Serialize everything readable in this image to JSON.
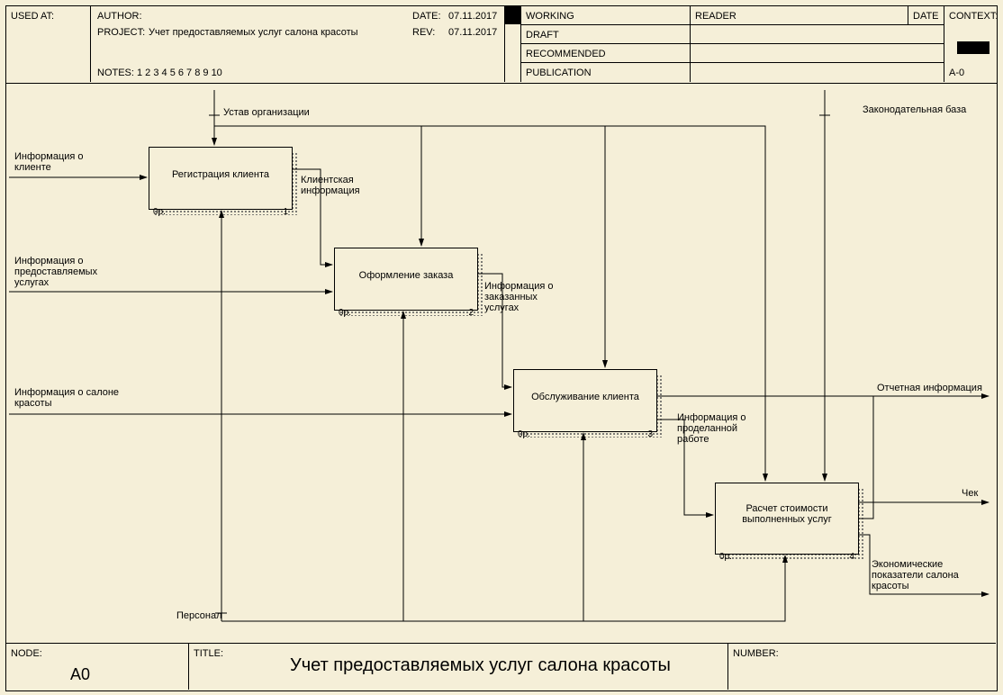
{
  "header": {
    "usedAt": "USED AT:",
    "author": "AUTHOR:",
    "project": "PROJECT:",
    "projectVal": "Учет предоставляемых услуг салона красоты",
    "notes": "NOTES:",
    "notesVal": "1 2 3 4 5 6 7 8 9 10",
    "date": "DATE:",
    "dateVal": "07.11.2017",
    "rev": "REV:",
    "revVal": "07.11.2017",
    "working": "WORKING",
    "draft": "DRAFT",
    "recommended": "RECOMMENDED",
    "publication": "PUBLICATION",
    "reader": "READER",
    "readerDate": "DATE",
    "context": "CONTEXT:",
    "contextVal": "A-0"
  },
  "footer": {
    "nodeLbl": "NODE:",
    "nodeVal": "A0",
    "titleLbl": "TITLE:",
    "titleVal": "Учет предоставляемых услуг салона красоты",
    "numberLbl": "NUMBER:"
  },
  "boxes": {
    "b1": {
      "title": "Регистрация клиента",
      "p": "0р.",
      "n": "1"
    },
    "b2": {
      "title": "Оформление заказа",
      "p": "0р.",
      "n": "2"
    },
    "b3": {
      "title": "Обслуживание клиента",
      "p": "0р.",
      "n": "3"
    },
    "b4": {
      "title": "Расчет стоимости выполненных услуг",
      "p": "0р.",
      "n": "4"
    }
  },
  "labels": {
    "ustav": "Устав организации",
    "zakon": "Законодательная база",
    "infoClient": "Информация о клиенте",
    "klientInfo": "Клиентская информация",
    "infoUslugi": "Информация о предоставляемых услугах",
    "infoZakaz": "Информация о заказанных услугах",
    "infoSalon": "Информация о салоне красоты",
    "otchet": "Отчетная информация",
    "infoWork": "Информация о проделанной работе",
    "chek": "Чек",
    "ekonom": "Экономические показатели салона красоты",
    "personal": "Персонал"
  }
}
